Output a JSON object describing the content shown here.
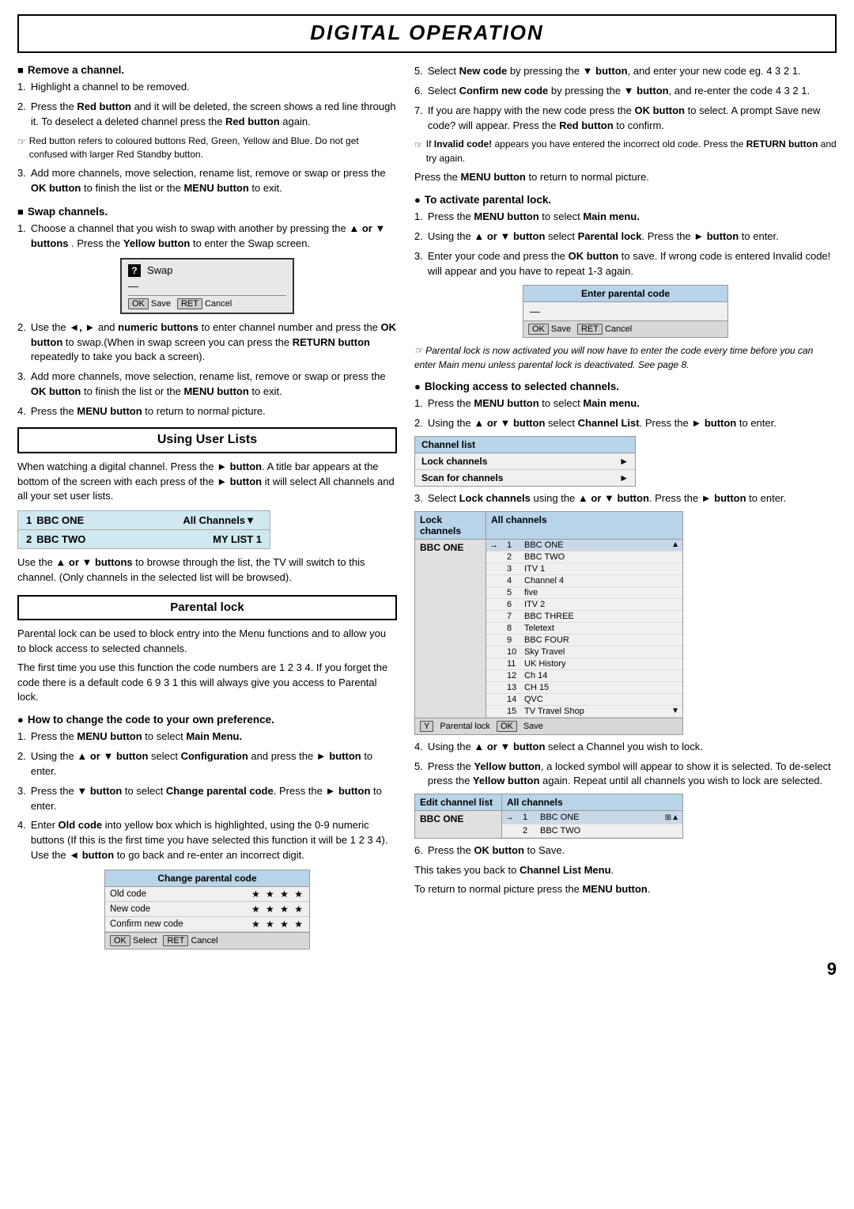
{
  "page": {
    "title": "DIGITAL OPERATION",
    "page_number": "9"
  },
  "left_col": {
    "remove_channel": {
      "heading": "Remove a channel.",
      "items": [
        "Highlight a channel to be removed.",
        "Press the Red button and it will be deleted, the screen shows a red line through it. To deselect a deleted channel press the Red button again.",
        "Red button refers to coloured buttons Red, Green, Yellow and Blue. Do not get confused with larger Red Standby button.",
        "Add more channels, move selection, rename list, remove or swap or press the OK button to finish the list or the MENU button to exit."
      ]
    },
    "swap_channels": {
      "heading": "Swap channels.",
      "items": [
        "Choose a channel that you wish to swap with another by pressing the ▲ or ▼ buttons . Press the Yellow button to enter the Swap screen.",
        "Use the ◄, ► and numeric buttons to enter channel number and press the OK button to swap.(When in swap screen you can press the RETURN button repeatedly to take you back a screen).",
        "Add more channels, move selection, rename list, remove or swap or press the OK button to finish the list or the MENU button to exit.",
        "Press the MENU button to return to normal picture."
      ]
    },
    "swap_box": {
      "title": "Swap",
      "dash": "—",
      "btn1_label": "OK",
      "btn1_text": "Save",
      "btn2_label": "RET",
      "btn2_text": "Cancel"
    },
    "using_user_lists": {
      "heading": "Using User Lists",
      "intro": "When watching a digital channel. Press the ► button. A title bar appears at the bottom of the screen with each press of the ► button it will select All channels and all your set user lists.",
      "rows": [
        {
          "num": "1",
          "name": "BBC ONE",
          "list": "All Channels"
        },
        {
          "num": "2",
          "name": "BBC TWO",
          "list": "MY LIST 1"
        }
      ],
      "description": "Use the ▲ or ▼ buttons to browse through the list, the TV will switch to this channel. (Only channels in the selected list will be browsed)."
    },
    "parental_lock": {
      "heading": "Parental lock",
      "intro": "Parental lock can be used to block entry into the Menu functions and to allow you to block access to selected channels.",
      "para2": "The first time you use this function the code numbers are 1 2 3 4. If you forget the code there is a default code 6 9 3 1 this will always give you access to Parental lock.",
      "how_to_change": {
        "heading": "How to change the code to your own preference.",
        "items": [
          "Press the MENU button to select Main Menu.",
          "Using the ▲ or ▼ button select Configuration and press the ► button to enter.",
          "Press the ▼ button to select Change parental code. Press the ► button to enter.",
          "Enter Old code into yellow box which is highlighted, using the 0-9 numeric buttons (If this is the first time you have selected this function it will be 1 2 3 4). Use the ◄ button to go back and re-enter an incorrect digit."
        ]
      },
      "change_code_box": {
        "header": "Change parental code",
        "rows": [
          {
            "label": "Old code",
            "stars": "★ ★ ★ ★"
          },
          {
            "label": "New code",
            "stars": "★ ★ ★ ★"
          },
          {
            "label": "Confirm new code",
            "stars": "★ ★ ★ ★"
          }
        ],
        "btn1_label": "OK",
        "btn1_text": "Select",
        "btn2_label": "RET",
        "btn2_text": "Cancel"
      }
    }
  },
  "right_col": {
    "items_5_7": [
      "Select New code by pressing the ▼ button, and enter your new code eg. 4 3 2 1.",
      "Select Confirm new code by pressing the ▼ button, and re-enter the code 4 3 2 1.",
      "If you are happy with the new code press the OK button to select. A prompt Save new code? will appear. Press the Red button to confirm."
    ],
    "note_invalid": "If Invalid code! appears you have entered the incorrect old code. Press the RETURN button and try again.",
    "menu_return": "Press the MENU button to return to normal picture.",
    "activate_parental": {
      "heading": "To activate parental lock.",
      "items": [
        "Press the MENU button to select Main menu.",
        "Using the ▲ or ▼ button select Parental lock. Press the ► button to enter.",
        "Enter your code and press the OK button to save. If wrong code is entered Invalid code! will appear and you have to repeat 1-3 again."
      ]
    },
    "enter_parental_box": {
      "header": "Enter parental code",
      "dash": "—",
      "btn1_label": "OK",
      "btn1_text": "Save",
      "btn2_label": "RET",
      "btn2_text": "Cancel"
    },
    "parental_note": "Parental lock is now activated you will now have to enter the code every time before you can enter Main menu unless parental lock is deactivated. See page 8.",
    "blocking_access": {
      "heading": "Blocking access to selected channels.",
      "items": [
        "Press the MENU button to select Main menu.",
        "Using the ▲ or ▼ button select Channel List. Press the ► button to enter."
      ]
    },
    "channel_list_box": {
      "header": "Channel list",
      "rows": [
        {
          "label": "Lock channels",
          "arrow": "►"
        },
        {
          "label": "Scan for channels",
          "arrow": "►"
        }
      ]
    },
    "blocking_item3": "Select Lock channels using the ▲ or ▼ button. Press the ► button to enter.",
    "lock_channels_box": {
      "col1_header": "Lock channels",
      "col2_header": "All channels",
      "left_label": "BBC ONE",
      "channels": [
        {
          "n": "1",
          "name": "BBC ONE",
          "highlight": true
        },
        {
          "n": "2",
          "name": "BBC TWO",
          "highlight": false
        },
        {
          "n": "3",
          "name": "ITV 1",
          "highlight": false
        },
        {
          "n": "4",
          "name": "Channel 4",
          "highlight": false
        },
        {
          "n": "5",
          "name": "five",
          "highlight": false
        },
        {
          "n": "6",
          "name": "ITV 2",
          "highlight": false
        },
        {
          "n": "7",
          "name": "BBC THREE",
          "highlight": false
        },
        {
          "n": "8",
          "name": "Teletext",
          "highlight": false
        },
        {
          "n": "9",
          "name": "BBC FOUR",
          "highlight": false
        },
        {
          "n": "10",
          "name": "Sky Travel",
          "highlight": false
        },
        {
          "n": "11",
          "name": "UK History",
          "highlight": false
        },
        {
          "n": "12",
          "name": "Ch 14",
          "highlight": false
        },
        {
          "n": "13",
          "name": "CH 15",
          "highlight": false
        },
        {
          "n": "14",
          "name": "QVC",
          "highlight": false
        },
        {
          "n": "15",
          "name": "TV Travel Shop",
          "highlight": false
        }
      ],
      "btn_y": "Y",
      "btn_y_text": "Parental lock",
      "btn_ok": "OK",
      "btn_ok_text": "Save"
    },
    "items_4_6": [
      "Using the ▲ or ▼ button select a Channel you wish to lock.",
      "Press the Yellow button, a locked symbol will appear to show it is selected. To  de-select press the Yellow button again. Repeat until all channels you wish to lock are selected."
    ],
    "edit_channel_box": {
      "col1_header": "Edit channel list",
      "col2_header": "All channels",
      "left_label": "BBC ONE",
      "channels": [
        {
          "n": "1",
          "name": "BBC ONE",
          "highlight": true,
          "icon": "⊞▲"
        },
        {
          "n": "2",
          "name": "BBC TWO",
          "highlight": false,
          "icon": ""
        }
      ]
    },
    "item6": "Press the OK button to Save.",
    "para_channel_list": "This takes you back to Channel List Menu.",
    "para_normal": "To return to normal picture press the MENU button."
  }
}
